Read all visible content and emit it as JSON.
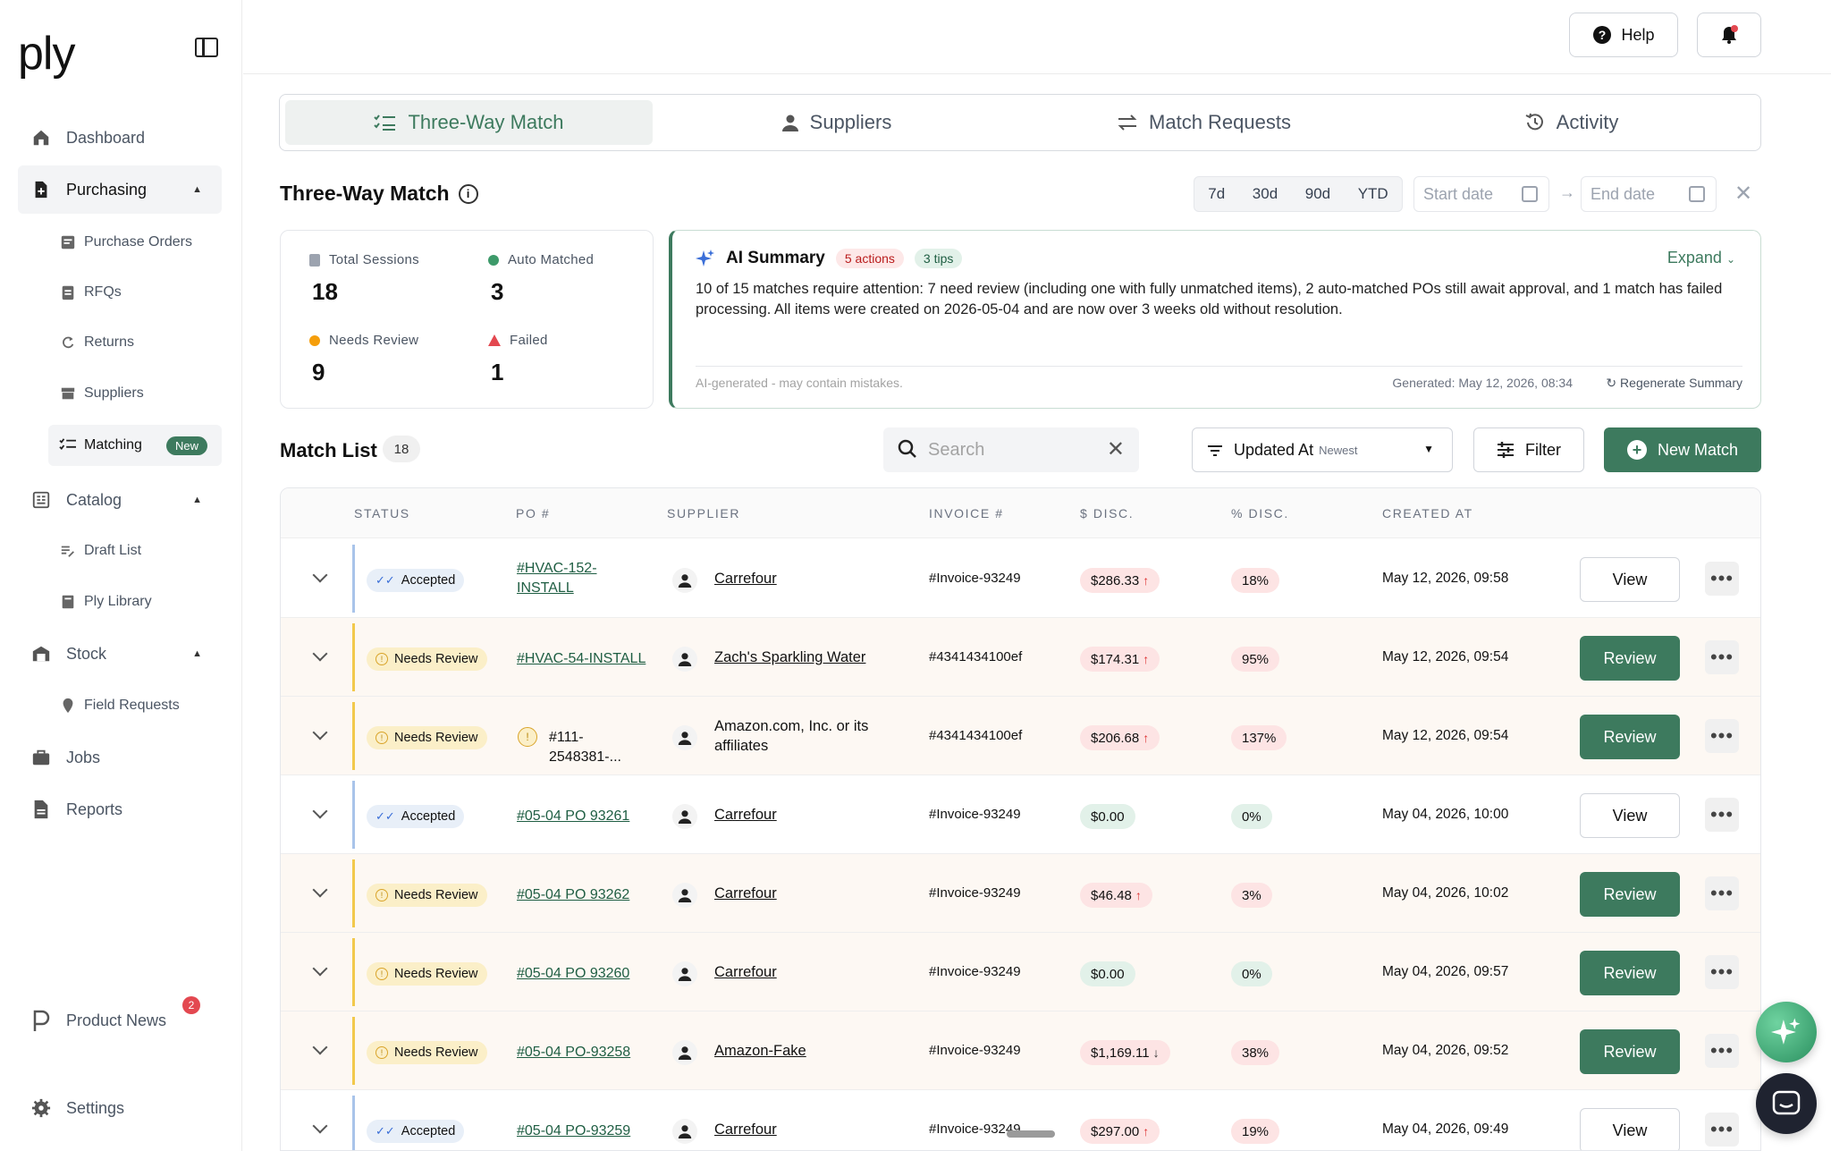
{
  "app": {
    "logo": "ply"
  },
  "sidebar": {
    "dashboard": "Dashboard",
    "purchasing": "Purchasing",
    "purchase_orders": "Purchase Orders",
    "rfqs": "RFQs",
    "returns": "Returns",
    "suppliers": "Suppliers",
    "matching": "Matching",
    "matching_badge": "New",
    "catalog": "Catalog",
    "draft_list": "Draft List",
    "ply_library": "Ply Library",
    "stock": "Stock",
    "field_requests": "Field Requests",
    "jobs": "Jobs",
    "reports": "Reports",
    "product_news": "Product News",
    "product_news_count": "2",
    "settings": "Settings"
  },
  "header": {
    "help": "Help"
  },
  "tabs": {
    "three_way": "Three-Way Match",
    "suppliers": "Suppliers",
    "match_requests": "Match Requests",
    "activity": "Activity"
  },
  "section": {
    "title": "Three-Way Match",
    "ranges": [
      "7d",
      "30d",
      "90d",
      "YTD"
    ],
    "start_placeholder": "Start date",
    "end_placeholder": "End date",
    "arrow": "→",
    "clear": "✕"
  },
  "stats": {
    "total_label": "Total Sessions",
    "total_value": "18",
    "auto_label": "Auto Matched",
    "auto_value": "3",
    "review_label": "Needs Review",
    "review_value": "9",
    "failed_label": "Failed",
    "failed_value": "1"
  },
  "ai": {
    "title": "AI Summary",
    "actions": "5 actions",
    "tips": "3 tips",
    "expand": "Expand",
    "text": "10 of 15 matches require attention: 7 need review (including one with fully unmatched items), 2 auto-matched POs still await approval, and 1 match has failed processing. All items were created on 2026-05-04 and are now over 3 weeks old without resolution.",
    "disclaimer": "AI-generated - may contain mistakes.",
    "generated": "Generated: May 12, 2026, 08:34",
    "regenerate": "Regenerate Summary"
  },
  "list": {
    "title": "Match List",
    "count": "18",
    "search_placeholder": "Search",
    "sort_label": "Updated At",
    "sort_sub": "Newest",
    "filter": "Filter",
    "new_match": "New Match"
  },
  "columns": {
    "status": "STATUS",
    "po": "PO #",
    "supplier": "SUPPLIER",
    "invoice": "INVOICE #",
    "disc_amt": "$ DISC.",
    "disc_pct": "% DISC.",
    "created": "CREATED AT"
  },
  "rows": [
    {
      "status": "Accepted",
      "po": "#HVAC-152-INSTALL",
      "supplier": "Carrefour",
      "invoice": "#Invoice-93249",
      "disc": "$286.33",
      "pct": "18%",
      "created": "May 12, 2026, 09:58",
      "action": "View"
    },
    {
      "status": "Needs Review",
      "po": "#HVAC-54-INSTALL",
      "supplier": "Zach's Sparkling Water",
      "invoice": "#4341434100ef",
      "disc": "$174.31",
      "pct": "95%",
      "created": "May 12, 2026, 09:54",
      "action": "Review"
    },
    {
      "status": "Needs Review",
      "po": "#111-2548381-...",
      "supplier": "Amazon.com, Inc. or its affiliates",
      "invoice": "#4341434100ef",
      "disc": "$206.68",
      "pct": "137%",
      "created": "May 12, 2026, 09:54",
      "action": "Review"
    },
    {
      "status": "Accepted",
      "po": "#05-04 PO 93261",
      "supplier": "Carrefour",
      "invoice": "#Invoice-93249",
      "disc": "$0.00",
      "pct": "0%",
      "created": "May 04, 2026, 10:00",
      "action": "View"
    },
    {
      "status": "Needs Review",
      "po": "#05-04 PO 93262",
      "supplier": "Carrefour",
      "invoice": "#Invoice-93249",
      "disc": "$46.48",
      "pct": "3%",
      "created": "May 04, 2026, 10:02",
      "action": "Review"
    },
    {
      "status": "Needs Review",
      "po": "#05-04 PO 93260",
      "supplier": "Carrefour",
      "invoice": "#Invoice-93249",
      "disc": "$0.00",
      "pct": "0%",
      "created": "May 04, 2026, 09:57",
      "action": "Review"
    },
    {
      "status": "Needs Review",
      "po": "#05-04 PO-93258",
      "supplier": "Amazon-Fake",
      "invoice": "#Invoice-93249",
      "disc": "$1,169.11",
      "pct": "38%",
      "created": "May 04, 2026, 09:52",
      "action": "Review"
    },
    {
      "status": "Accepted",
      "po": "#05-04 PO-93259",
      "supplier": "Carrefour",
      "invoice": "#Invoice-93249",
      "disc": "$297.00",
      "pct": "19%",
      "created": "May 04, 2026, 09:49",
      "action": "View"
    }
  ],
  "more_label": "•••",
  "colors": {
    "brand": "#3d7a5e",
    "accepted_bg": "#e8eff8",
    "review_bg": "#fbefc8",
    "disc_red": "#fde4e4",
    "disc_green": "#e2f1e9"
  }
}
